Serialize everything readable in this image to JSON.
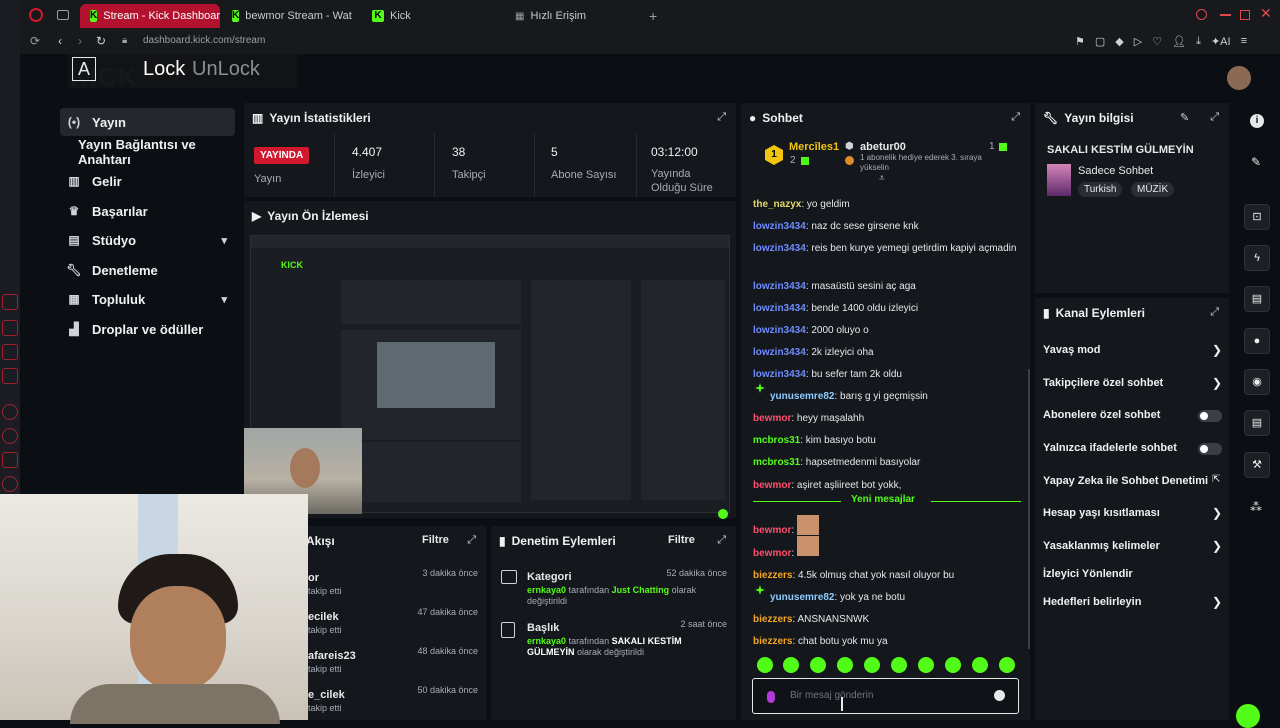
{
  "browser": {
    "tabs": [
      {
        "label": "Stream - Kick Dashboard"
      },
      {
        "label": "bewmor Stream - Wat"
      },
      {
        "label": "Kick"
      },
      {
        "label": "Hızlı Erişim"
      }
    ],
    "url": "dashboard.kick.com/stream",
    "ai_label": "AI"
  },
  "overlay": {
    "key": "A",
    "lock": "Lock",
    "unlock": "UnLock"
  },
  "sidebar": {
    "items": [
      {
        "label": "Yayın"
      },
      {
        "label": "Yayın Bağlantısı ve Anahtarı"
      },
      {
        "label": "Gelir"
      },
      {
        "label": "Başarılar"
      },
      {
        "label": "Stüdyo"
      },
      {
        "label": "Denetleme"
      },
      {
        "label": "Topluluk"
      },
      {
        "label": "Droplar ve ödüller"
      }
    ]
  },
  "stats": {
    "title": "Yayın İstatistikleri",
    "live_badge": "YAYINDA",
    "items": [
      {
        "value": "",
        "label": "Yayın"
      },
      {
        "value": "4.407",
        "label": "İzleyici"
      },
      {
        "value": "38",
        "label": "Takipçi"
      },
      {
        "value": "5",
        "label": "Abone Sayısı"
      },
      {
        "value": "03:12:00",
        "label": "Yayında Olduğu Süre"
      }
    ]
  },
  "preview": {
    "title": "Yayın Ön İzlemesi"
  },
  "activity": {
    "title": "Akışı",
    "filter": "Filtre",
    "items": [
      {
        "user": "or",
        "action": "takip etti",
        "time": "3 dakika önce"
      },
      {
        "user": "ecilek",
        "action": "takip etti",
        "time": "47 dakika önce"
      },
      {
        "user": "afareis23",
        "action": "takip etti",
        "time": "48 dakika önce"
      },
      {
        "user": "e_cilek",
        "action": "takip etti",
        "time": "50 dakika önce"
      }
    ]
  },
  "moderation": {
    "title": "Denetim Eylemleri",
    "filter": "Filtre",
    "items": [
      {
        "title": "Kategori",
        "time": "52 dakika önce",
        "actor": "ernkaya0",
        "middle": "tarafından",
        "value": "Just Chatting",
        "suffix": "olarak değiştirildi"
      },
      {
        "title": "Başlık",
        "time": "2 saat önce",
        "actor": "ernkaya0",
        "middle": "tarafından",
        "value": "SAKALI KESTİM GÜLMEYİN",
        "suffix": "olarak değiştirildi"
      }
    ]
  },
  "chat": {
    "title": "Sohbet",
    "top1_name": "Mercîles1",
    "top1_count": "2",
    "top2_name": "abetur00",
    "top2_count": "1",
    "top2_note": "1 abonelik hediye ederek 3. sıraya yükselin",
    "new_messages": "Yeni mesajlar",
    "input_placeholder": "Bir mesaj gönderin",
    "messages": [
      {
        "user": "the_nazyx",
        "text": ": yo geldim",
        "color": "#e7d96a"
      },
      {
        "user": "lowzin3434",
        "text": ": naz dc sese girsene knk",
        "color": "#6f8cff"
      },
      {
        "user": "lowzin3434",
        "text": ": reis ben kurye yemegi getirdim kapiyi açmadin",
        "color": "#6f8cff"
      },
      {
        "user": "lowzin3434",
        "text": ": masaüstü sesini aç aga",
        "color": "#6f8cff"
      },
      {
        "user": "lowzin3434",
        "text": ": bende 1400 oldu izleyici",
        "color": "#6f8cff"
      },
      {
        "user": "lowzin3434",
        "text": ": 2000 oluyo o",
        "color": "#6f8cff"
      },
      {
        "user": "lowzin3434",
        "text": ": 2k izleyici oha",
        "color": "#6f8cff"
      },
      {
        "user": "lowzin3434",
        "text": ": bu sefer tam 2k oldu",
        "color": "#6f8cff"
      },
      {
        "user": "yunusemre82",
        "text": ": barış g yi geçmişsin",
        "color": "#8ecbff"
      },
      {
        "user": "bewmor",
        "text": ": heyy maşalahh",
        "color": "#ff4f6d"
      },
      {
        "user": "mcbros31",
        "text": ": kim basıyo botu",
        "color": "#53fc18"
      },
      {
        "user": "mcbros31",
        "text": ": hapsetmedenmi basıyolar",
        "color": "#53fc18"
      },
      {
        "user": "bewmor",
        "text": ": aşiret aşliireet bot yokk,",
        "color": "#ff4f6d"
      },
      {
        "user": "bewmor",
        "text": ":",
        "color": "#ff4f6d"
      },
      {
        "user": "bewmor",
        "text": ":",
        "color": "#ff4f6d"
      },
      {
        "user": "biezzers",
        "text": ": 4.5k olmuş chat yok nasıl oluyor bu",
        "color": "#f5a623"
      },
      {
        "user": "yunusemre82",
        "text": ": yok ya ne botu",
        "color": "#8ecbff"
      },
      {
        "user": "biezzers",
        "text": ": ANSNANSNWK",
        "color": "#f5a623"
      },
      {
        "user": "biezzers",
        "text": ": chat botu yok mu ya",
        "color": "#f5a623"
      }
    ]
  },
  "stream_info": {
    "title": "Yayın bilgisi",
    "stream_title": "SAKALI KESTİM GÜLMEYİN",
    "category": "Sadece Sohbet",
    "tags": [
      "Turkish",
      "MÜZİK"
    ]
  },
  "channel_actions": {
    "title": "Kanal Eylemleri",
    "items": [
      {
        "label": "Yavaş mod"
      },
      {
        "label": "Takipçilere özel sohbet"
      },
      {
        "label": "Abonelere özel sohbet"
      },
      {
        "label": "Yalnızca ifadelerle sohbet"
      },
      {
        "label": "Yapay Zeka ile Sohbet Denetimi"
      },
      {
        "label": "Hesap yaşı kısıtlaması"
      },
      {
        "label": "Yasaklanmış kelimeler"
      },
      {
        "label": "İzleyici Yönlendir"
      },
      {
        "label": "Hedefleri belirleyin"
      }
    ]
  },
  "colors": {
    "kick_green": "#53fc18",
    "live_red": "#d1182e",
    "tab_red": "#b3122e"
  }
}
